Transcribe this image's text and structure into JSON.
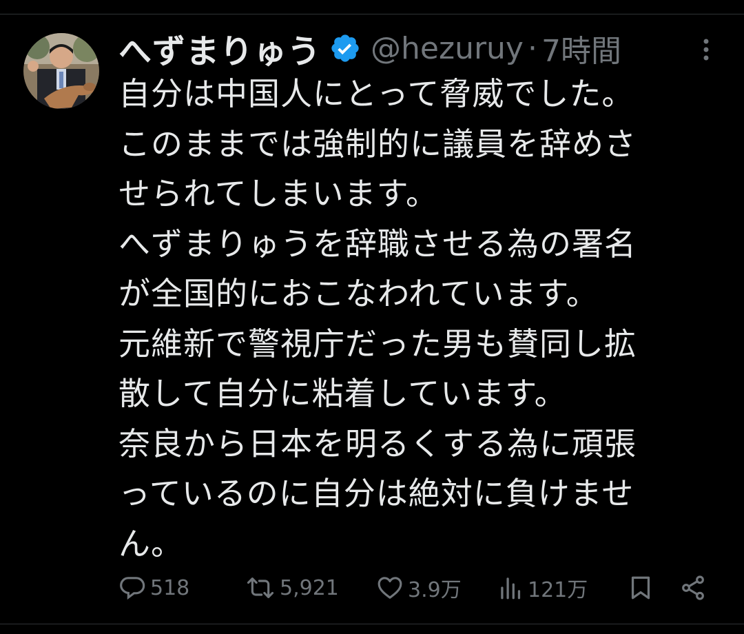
{
  "tweet": {
    "display_name": "へずまりゅう",
    "handle": "@hezuruy",
    "separator": "·",
    "time": "7時間",
    "lines": [
      "自分は中国人にとって脅威でした。",
      "このままでは強制的に議員を辞めさ",
      "せられてしまいます。",
      "へずまりゅうを辞職させる為の署名",
      "が全国的におこなわれています。",
      "元維新で警視庁だった男も賛同し拡",
      "散して自分に粘着しています。",
      "奈良から日本を明るくする為に頑張",
      "っているのに自分は絶対に負けませ",
      "ん。"
    ]
  },
  "icons": {
    "verified": "verified-badge-icon",
    "more": "more-icon",
    "reply": "reply-icon",
    "retweet": "retweet-icon",
    "like": "heart-icon",
    "views": "views-icon",
    "bookmark": "bookmark-icon",
    "share": "share-icon"
  },
  "actions": {
    "replies": "518",
    "retweets": "5,921",
    "likes": "3.9万",
    "views": "121万"
  },
  "colors": {
    "background": "#000000",
    "text": "#e7e9ea",
    "secondary": "#71767b",
    "verified": "#1d9bf0"
  }
}
